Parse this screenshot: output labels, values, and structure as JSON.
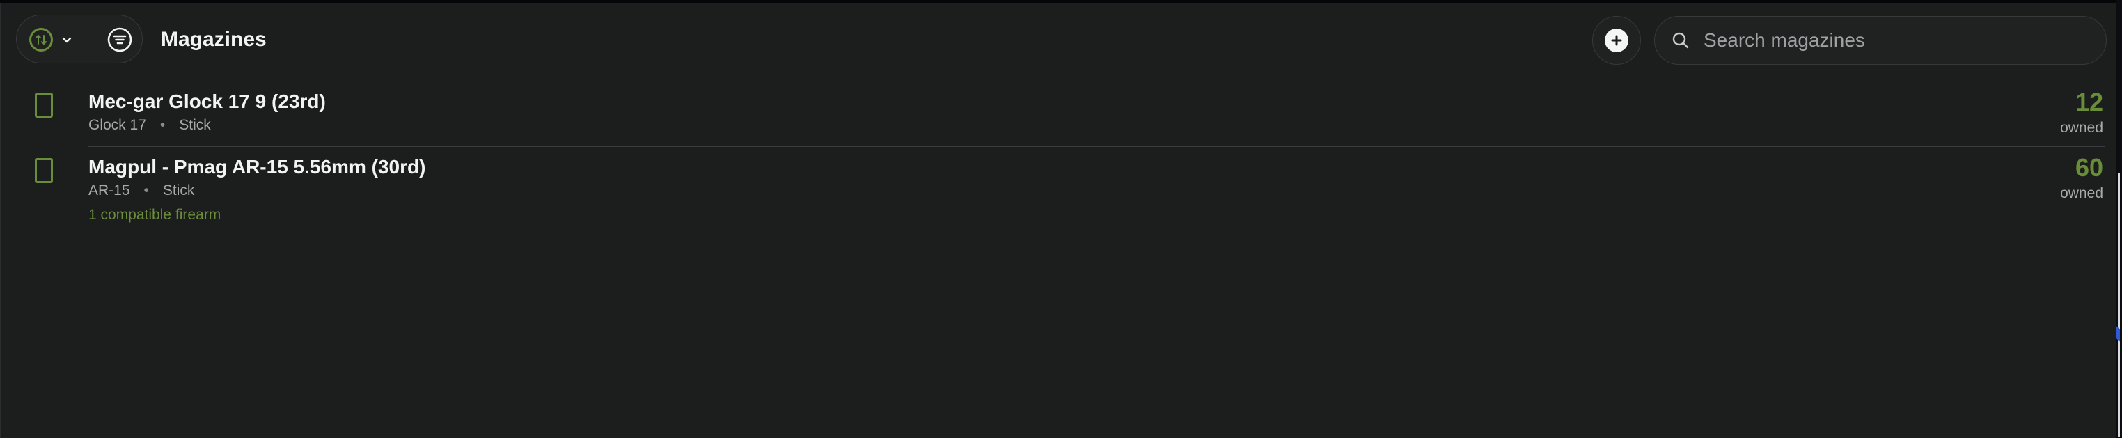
{
  "header": {
    "title": "Magazines",
    "sort_icon": "sort-arrows-icon",
    "filter_icon": "filter-lines-icon",
    "add_icon": "plus-icon"
  },
  "search": {
    "placeholder": "Search magazines",
    "value": ""
  },
  "colors": {
    "accent": "#6a8d3a",
    "background": "#1c1d1d",
    "text": "#f2f3f3",
    "muted": "#a7aaab"
  },
  "magazines": [
    {
      "name": "Mec-gar Glock 17 9 (23rd)",
      "platform": "Glock 17",
      "type": "Stick",
      "compatible": "",
      "count": "12",
      "owned_label": "owned"
    },
    {
      "name": "Magpul - Pmag AR-15 5.56mm (30rd)",
      "platform": "AR-15",
      "type": "Stick",
      "compatible": "1 compatible firearm",
      "count": "60",
      "owned_label": "owned"
    }
  ]
}
